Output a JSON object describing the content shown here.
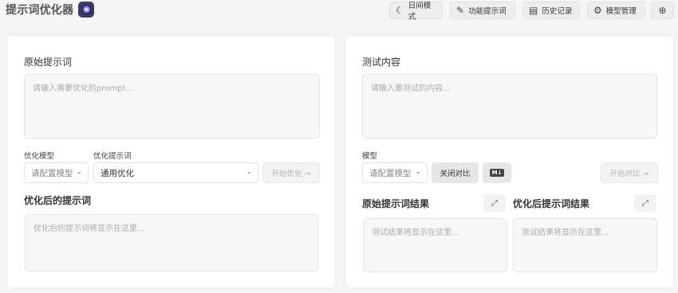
{
  "header": {
    "title": "提示词优化器",
    "buttons": {
      "day_mode": "日间模式",
      "function_prompts": "功能提示词",
      "history": "历史记录",
      "model_manage": "模型管理"
    },
    "icons": {
      "day_mode": "moon-icon",
      "function_prompts": "edit-icon",
      "history": "scroll-icon",
      "model_manage": "gear-icon",
      "language": "globe-icon"
    }
  },
  "left": {
    "original_title": "原始提示词",
    "original_placeholder": "请输入需要优化的prompt...",
    "model_label": "优化模型",
    "model_select": "请配置模型",
    "template_label": "优化提示词",
    "template_select": "通用优化",
    "start_button": "开始优化 →",
    "optimized_title": "优化后的提示词",
    "optimized_placeholder": "优化后的提示词将显示在这里..."
  },
  "right": {
    "test_title": "测试内容",
    "test_placeholder": "请输入要测试的内容...",
    "model_label": "模型",
    "model_select": "请配置模型",
    "compare_toggle": "关闭对比",
    "md_badge": "M↓",
    "start_compare": "开始对比 →",
    "original_result_title": "原始提示词结果",
    "optimized_result_title": "优化后提示词结果",
    "original_result_placeholder": "测试结果将显示在这里...",
    "optimized_result_placeholder": "测试结果将显示在这里..."
  },
  "colors": {
    "background": "#f5f5f6",
    "panel": "#ffffff",
    "logo": "#3b3a63"
  }
}
